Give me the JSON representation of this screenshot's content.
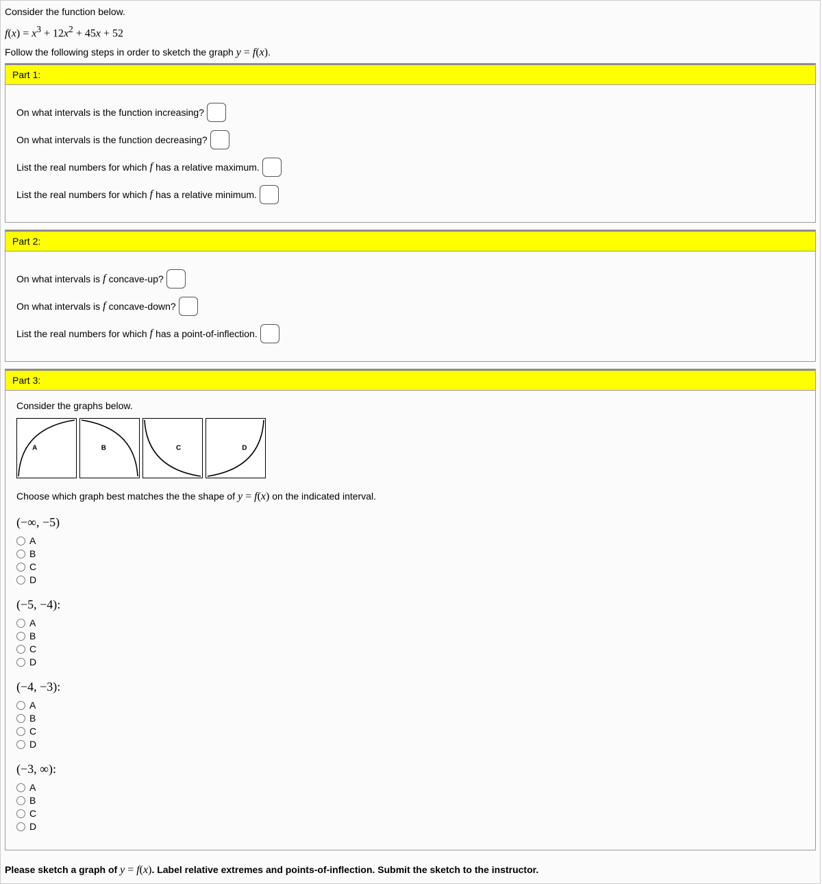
{
  "intro": {
    "prompt": "Consider the function below.",
    "formula_lhs": "f(x) = ",
    "formula_rhs": "x³ + 12x² + 45x + 52",
    "follow": "Follow the following steps in order to sketch the graph ",
    "follow_eq": "y = f(x)",
    "follow_end": "."
  },
  "part1": {
    "header": "Part 1:",
    "q1": "On what intervals is the function increasing?",
    "q2": "On what intervals is the function decreasing?",
    "q3a": "List the real numbers for which ",
    "q3b": " has a relative maximum.",
    "q4a": "List the real numbers for which ",
    "q4b": " has a relative minimum."
  },
  "part2": {
    "header": "Part 2:",
    "q1a": "On what intervals is ",
    "q1b": " concave-up?",
    "q2a": "On what intervals is ",
    "q2b": " concave-down?",
    "q3a": "List the real numbers for which ",
    "q3b": " has a point-of-inflection."
  },
  "part3": {
    "header": "Part 3:",
    "consider": "Consider the graphs below.",
    "graph_labels": {
      "a": "A",
      "b": "B",
      "c": "C",
      "d": "D"
    },
    "choose_pre": "Choose which graph best matches the the shape of ",
    "choose_eq": "y = f(x)",
    "choose_post": " on the indicated interval.",
    "intervals": {
      "i1": "(−∞, −5)",
      "i2": "(−5, −4):",
      "i3": "(−4, −3):",
      "i4": "(−3, ∞):"
    },
    "options": {
      "a": "A",
      "b": "B",
      "c": "C",
      "d": "D"
    }
  },
  "final": {
    "pre": "Please sketch a graph of ",
    "eq": "y = f(x)",
    "post": ". Label relative extremes and points-of-inflection. Submit the sketch to the instructor."
  },
  "f_symbol": "f"
}
